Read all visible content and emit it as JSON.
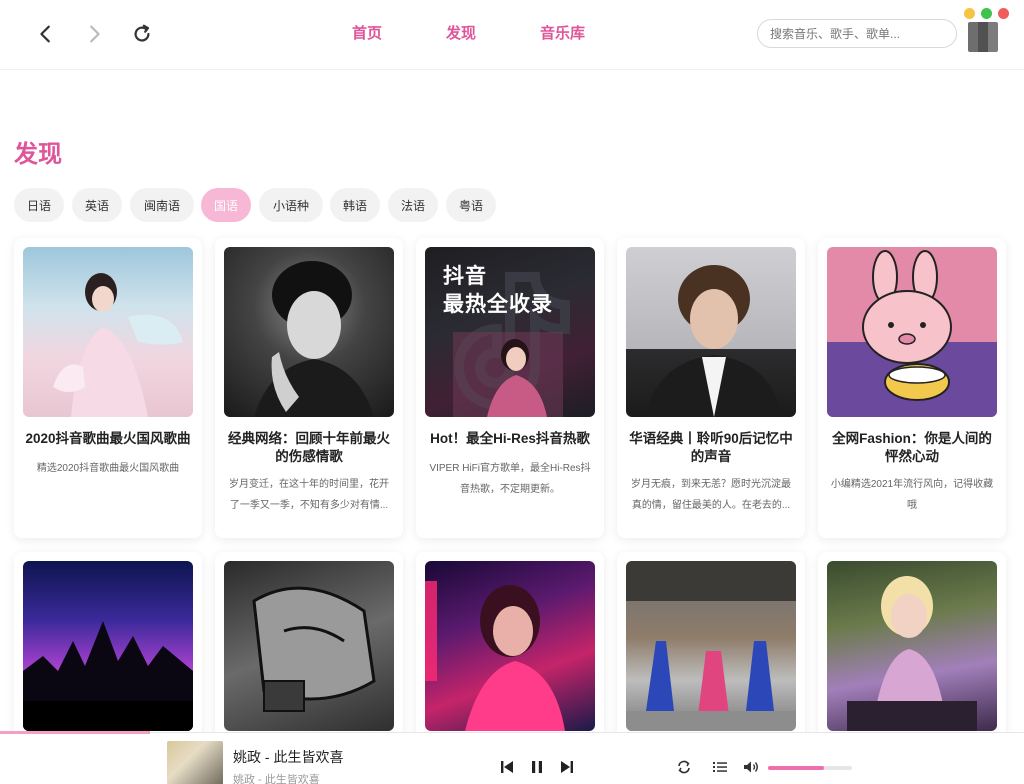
{
  "window": {
    "search_placeholder": "搜索音乐、歌手、歌单..."
  },
  "nav": {
    "items": [
      "首页",
      "发现",
      "音乐库"
    ]
  },
  "page_title": "发现",
  "tags": [
    {
      "label": "日语",
      "active": false
    },
    {
      "label": "英语",
      "active": false
    },
    {
      "label": "闽南语",
      "active": false
    },
    {
      "label": "国语",
      "active": true
    },
    {
      "label": "小语种",
      "active": false
    },
    {
      "label": "韩语",
      "active": false
    },
    {
      "label": "法语",
      "active": false
    },
    {
      "label": "粤语",
      "active": false
    }
  ],
  "playlists": [
    {
      "title": "2020抖音歌曲最火国风歌曲",
      "desc": "精选2020抖音歌曲最火国风歌曲",
      "icon": "cover-guofeng"
    },
    {
      "title": "经典网络：回顾十年前最火的伤感情歌",
      "desc": "岁月变迁，在这十年的时间里，花开了一季又一季，不知有多少对有情...",
      "icon": "cover-portrait-bw"
    },
    {
      "title": "Hot！最全Hi-Res抖音热歌",
      "desc": "VIPER HiFi官方歌单，最全Hi-Res抖音热歌，不定期更新。",
      "icon": "cover-douyin",
      "cover_text": "抖音\n最热全收录"
    },
    {
      "title": "华语经典丨聆听90后记忆中的声音",
      "desc": "岁月无痕，到来无恙？愿时光沉淀最真的情，留住最美的人。在老去的...",
      "icon": "cover-portrait-man"
    },
    {
      "title": "全网Fashion：你是人间的怦然心动",
      "desc": "小编精选2021年流行风向，记得收藏哦",
      "icon": "cover-rabbit"
    }
  ],
  "playlists_row2": [
    {
      "icon": "cover-concert"
    },
    {
      "icon": "cover-manga"
    },
    {
      "icon": "cover-dj-neon"
    },
    {
      "icon": "cover-dance"
    },
    {
      "icon": "cover-dj-blonde"
    }
  ],
  "player": {
    "title": "姚政 - 此生皆欢喜",
    "artist": "姚政 - 此生皆欢喜",
    "volume": 0.67,
    "progress": 0.15
  },
  "colors": {
    "accent": "#e0559a",
    "tag_active": "#f7b8d6"
  }
}
